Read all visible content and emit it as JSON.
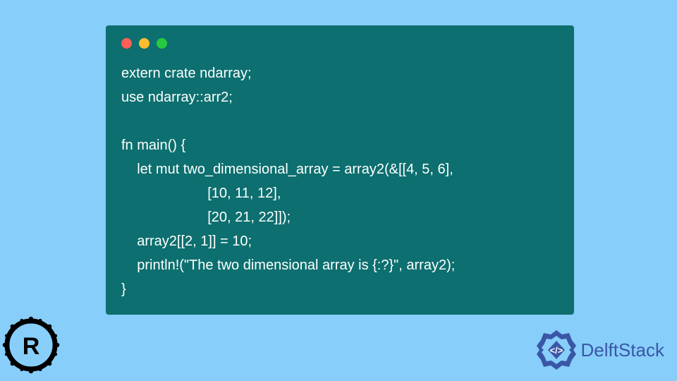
{
  "code": {
    "line1": "extern crate ndarray;",
    "line2": "use ndarray::arr2;",
    "line3": "",
    "line4": "fn main() {",
    "line5": "    let mut two_dimensional_array = array2(&[[4, 5, 6],",
    "line6": "                      [10, 11, 12],",
    "line7": "                      [20, 21, 22]]);",
    "line8": "    array2[[2, 1]] = 10;",
    "line9": "    println!(\"The two dimensional array is {:?}\", array2);",
    "line10": "}"
  },
  "branding": {
    "delft_text": "DelftStack"
  }
}
